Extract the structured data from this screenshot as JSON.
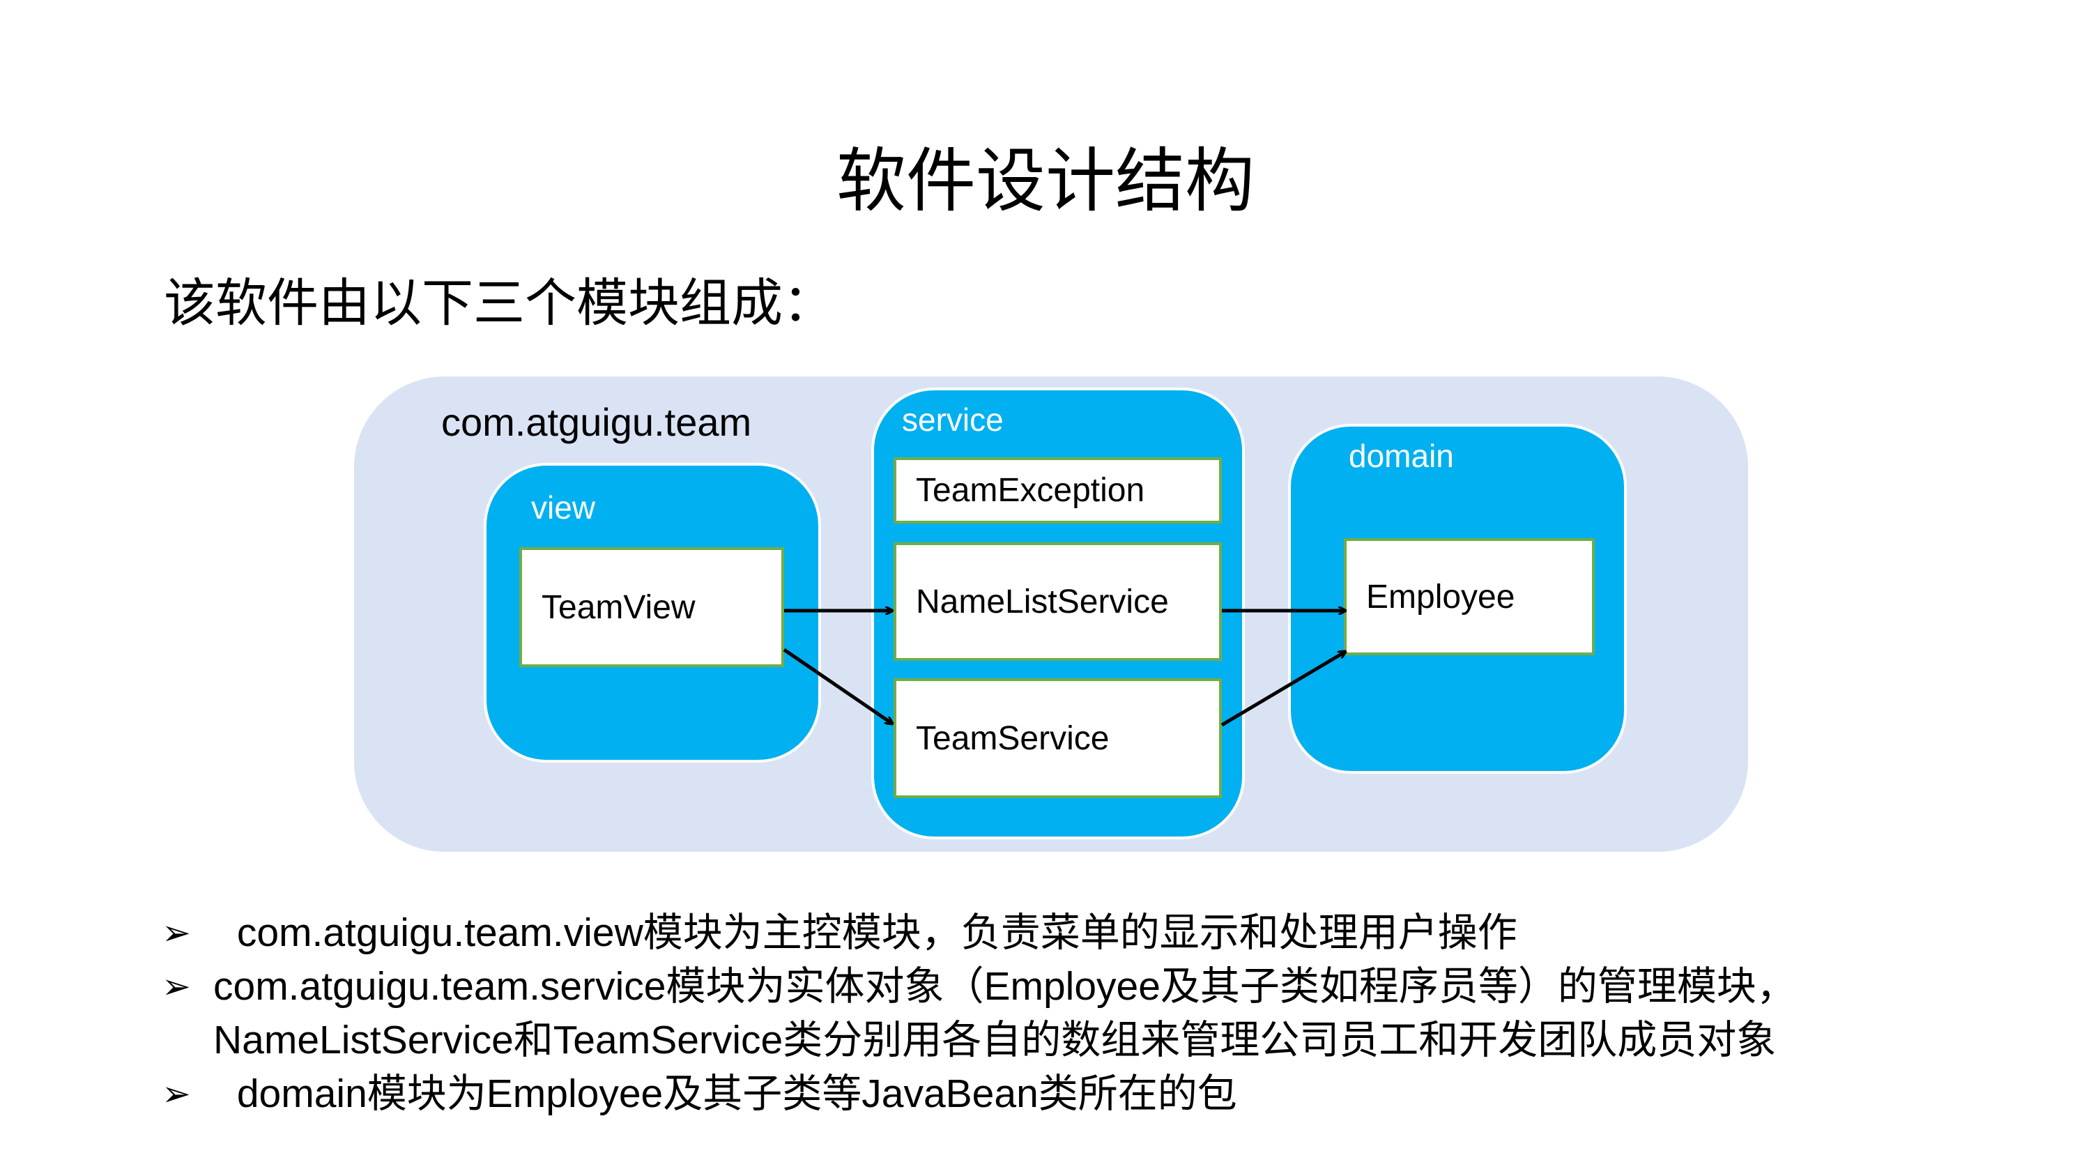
{
  "title": "软件设计结构",
  "subtitle": "该软件由以下三个模块组成：",
  "diagram": {
    "package_label": "com.atguigu.team",
    "view": {
      "label": "view",
      "classes": [
        "TeamView"
      ]
    },
    "service": {
      "label": "service",
      "classes": [
        "TeamException",
        "NameListService",
        "TeamService"
      ]
    },
    "domain": {
      "label": "domain",
      "classes": [
        "Employee"
      ]
    }
  },
  "bullets": [
    {
      "mark": "➢",
      "lines": [
        " com.atguigu.team.view模块为主控模块，负责菜单的显示和处理用户操作"
      ]
    },
    {
      "mark": "➢",
      "lines": [
        "com.atguigu.team.service模块为实体对象（Employee及其子类如程序员等）的管理模块，",
        "NameListService和TeamService类分别用各自的数组来管理公司员工和开发团队成员对象"
      ]
    },
    {
      "mark": "➢",
      "lines": [
        " domain模块为Employee及其子类等JavaBean类所在的包"
      ]
    }
  ],
  "colors": {
    "module_fill": "#00b0f0",
    "package_fill": "#dae3f3",
    "class_border": "#70ad47"
  }
}
